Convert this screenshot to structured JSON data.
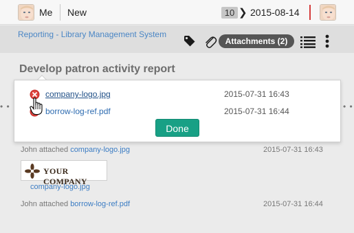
{
  "topbar": {
    "user_label": "Me",
    "new_label": "New",
    "count": "10",
    "chevron": "❯",
    "date": "2015-08-14"
  },
  "subbar": {
    "breadcrumb": "Reporting - Library Management System",
    "attachments_label": "Attachments (2)",
    "icons": [
      "tag-icon",
      "paperclip-icon",
      "list-icon",
      "more-vertical-icon"
    ]
  },
  "task": {
    "title": "Develop patron activity report"
  },
  "popover": {
    "attachments": [
      {
        "name": "company-logo.jpg",
        "date": "2015-07-31 16:43"
      },
      {
        "name": "borrow-log-ref.pdf",
        "date": "2015-07-31 16:44"
      }
    ],
    "done_label": "Done"
  },
  "history": [
    {
      "who": "John attached",
      "file": "company-logo.jpg",
      "date": "2015-07-31 16:43"
    },
    {
      "who": "John attached",
      "file": "borrow-log-ref.pdf",
      "date": "2015-07-31 16:44"
    }
  ],
  "preview": {
    "logo_text": "YOUR COMPANY",
    "caption": "company-logo.jpg"
  },
  "side_dots": "• •",
  "colors": {
    "accent": "#18a085",
    "link": "#3b7cc3",
    "separator_red": "#d43b3b"
  }
}
